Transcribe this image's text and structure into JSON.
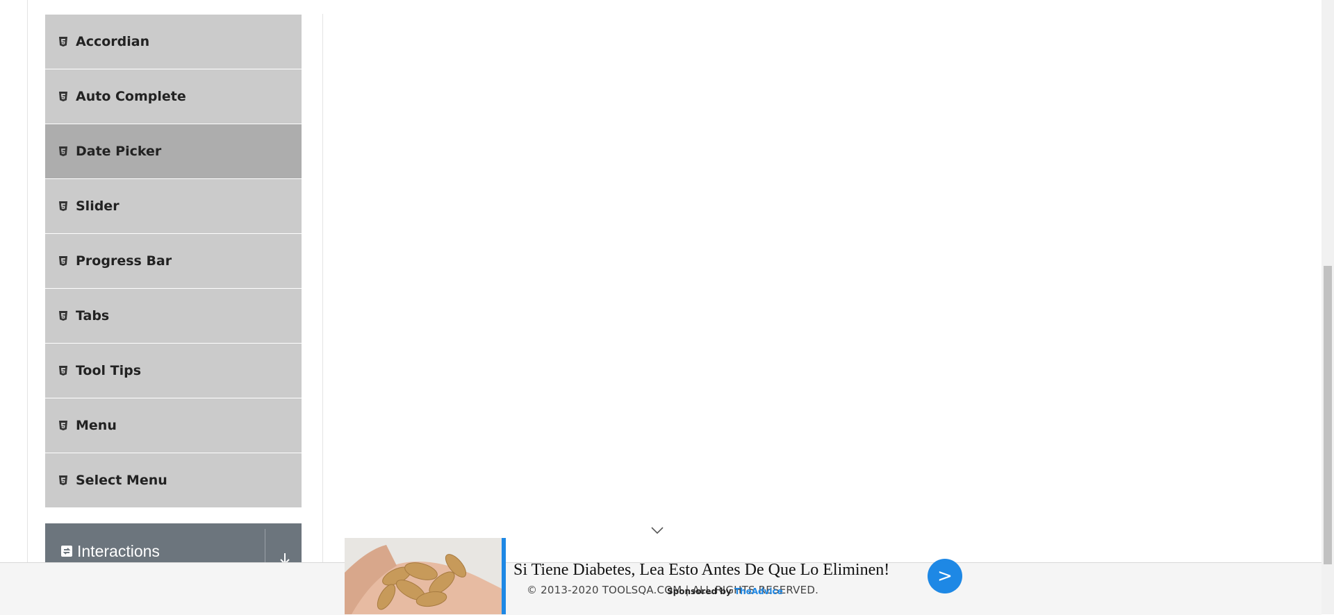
{
  "sidebar": {
    "items": [
      {
        "label": "Accordian"
      },
      {
        "label": "Auto Complete"
      },
      {
        "label": "Date Picker",
        "active": true
      },
      {
        "label": "Slider"
      },
      {
        "label": "Progress Bar"
      },
      {
        "label": "Tabs"
      },
      {
        "label": "Tool Tips"
      },
      {
        "label": "Menu"
      },
      {
        "label": "Select Menu"
      }
    ],
    "next_group": {
      "label": "Interactions"
    }
  },
  "footer": {
    "copyright": "© 2013-2020 TOOLSQA.COM | ALL RIGHTS RESERVED."
  },
  "ad": {
    "headline": "Si Tiene Diabetes, Lea Esto Antes De Que Lo Eliminen!",
    "sponsored_prefix": "Sponsored by",
    "sponsor": "TheAdvice",
    "go_label": ">",
    "accent_color": "#1e88e5"
  }
}
